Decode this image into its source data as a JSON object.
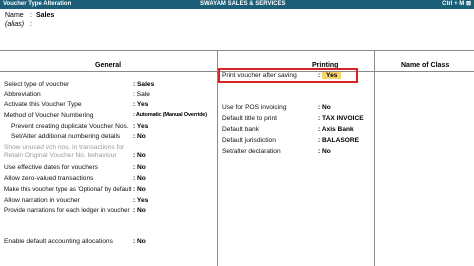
{
  "window": {
    "title": "Voucher Type Alteration",
    "company": "SWAYAM SALES & SERVICES",
    "close_symbol": "Ctrl + M  ⊠"
  },
  "name_section": {
    "name_label": "Name",
    "name_value": "Sales",
    "alias_label": "(alias)"
  },
  "general": {
    "heading": "General",
    "rows": [
      {
        "label": "Select type of voucher",
        "value": "Sales"
      },
      {
        "label": "Abbreviation",
        "value": "Sale"
      },
      {
        "label": "Activate this Voucher Type",
        "value": "Yes"
      },
      {
        "label": "Method of Voucher Numbering",
        "value": "Automatic (Manual Override)"
      },
      {
        "label": "Prevent creating duplicate Voucher Nos.",
        "value": "Yes"
      },
      {
        "label": "Set/Alter additional numbering details",
        "value": "No"
      },
      {
        "label": "Show unused vch nos. in transactions for",
        "label2": "Retain Original Voucher No. behaviour",
        "value": "No"
      },
      {
        "label": "Use effective dates for vouchers",
        "value": "No"
      },
      {
        "label": "Allow zero-valued transactions",
        "value": "No"
      },
      {
        "label": "Make this voucher type as 'Optional' by default",
        "value": "No"
      },
      {
        "label": "Allow narration in voucher",
        "value": "Yes"
      },
      {
        "label": "Provide narrations for each ledger in voucher",
        "value": "No"
      },
      {
        "label": "Enable default accounting allocations",
        "value": "No"
      }
    ]
  },
  "printing": {
    "heading": "Printing",
    "print_after_saving_label": "Print voucher after saving",
    "print_after_saving_value": "Yes",
    "rows": [
      {
        "label": "Use for POS invoicing",
        "value": "No"
      },
      {
        "label": "Default title to print",
        "value": "TAX INVOICE"
      },
      {
        "label": "Default bank",
        "value": "Axis Bank"
      },
      {
        "label": "Default jurisdiction",
        "value": "BALASORE"
      },
      {
        "label": "Set/alter declaration",
        "value": "No"
      }
    ]
  },
  "name_of_class": {
    "heading": "Name of Class"
  },
  "colors": {
    "titlebar": "#1b5e77",
    "highlight_border": "#d92222",
    "yes_highlight": "#f5d76e"
  }
}
